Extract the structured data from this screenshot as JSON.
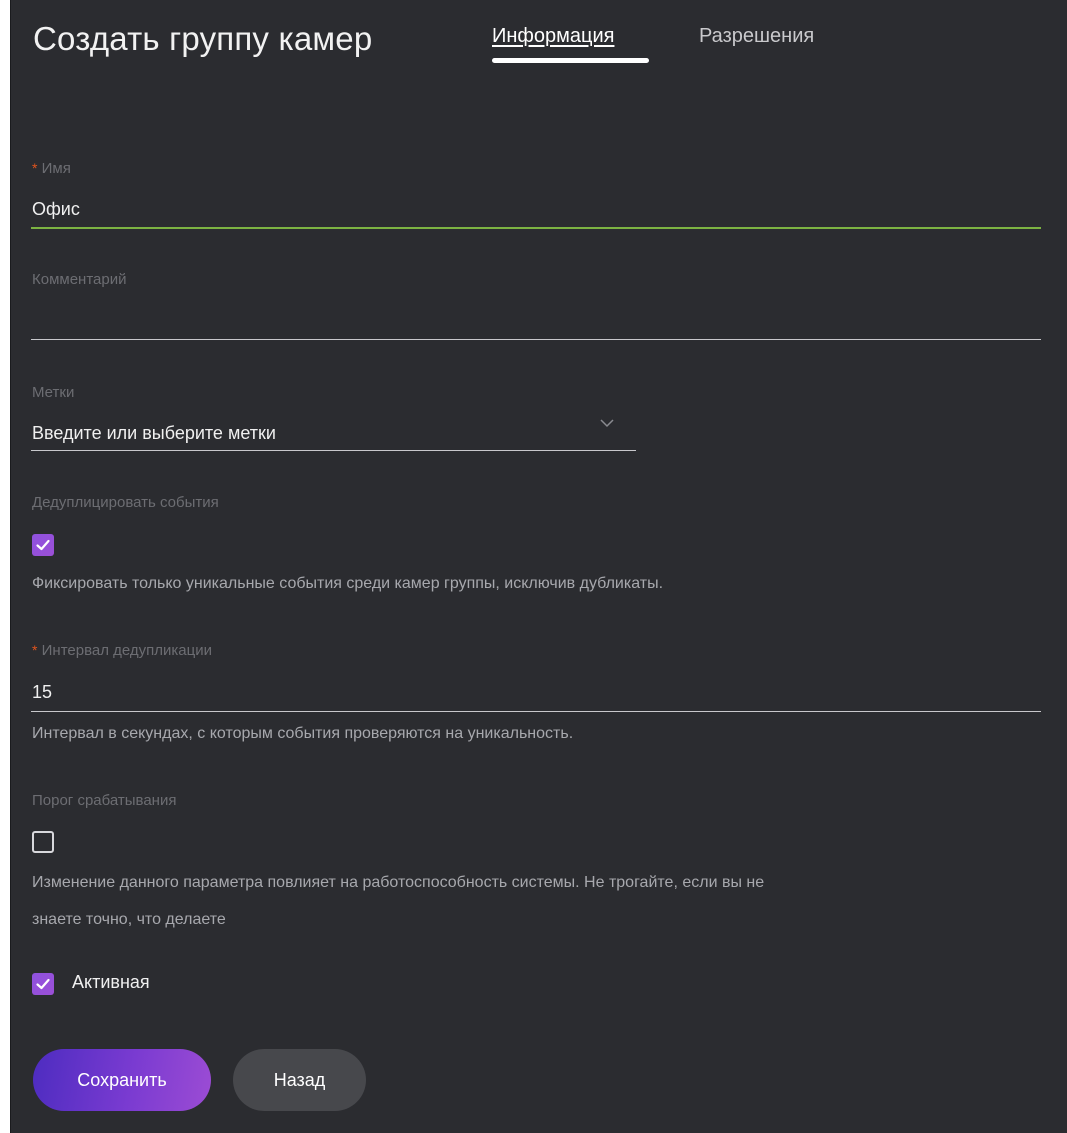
{
  "header": {
    "title": "Создать группу камер",
    "tabs": [
      {
        "label": "Информация",
        "active": true
      },
      {
        "label": "Разрешения",
        "active": false
      }
    ]
  },
  "form": {
    "name": {
      "label": "Имя",
      "required": true,
      "value": "Офис"
    },
    "comment": {
      "label": "Комментарий",
      "value": ""
    },
    "tags": {
      "label": "Метки",
      "placeholder": "Введите или выберите метки"
    },
    "dedup": {
      "label": "Дедуплицировать события",
      "checked": true,
      "hint": "Фиксировать только уникальные события среди камер группы, исключив дубликаты."
    },
    "dedup_interval": {
      "label": "Интервал дедупликации",
      "required": true,
      "value": "15",
      "hint": "Интервал в секундах, с которым события проверяются на уникальность."
    },
    "threshold": {
      "label": "Порог срабатывания",
      "checked": false,
      "hint_line1": "Изменение данного параметра повлияет на работоспособность системы. Не трогайте, если вы не",
      "hint_line2": "знаете точно, что делаете"
    },
    "active": {
      "label": "Активная",
      "checked": true
    }
  },
  "buttons": {
    "save_label": "Сохранить",
    "back_label": "Назад"
  },
  "colors": {
    "background": "#2b2c30",
    "accent": "#8f52df",
    "required": "#e2541d",
    "focus_underline": "#7cb342"
  },
  "icons": {
    "tags_dropdown": "chevron-down-icon",
    "checkmark": "checkmark-icon"
  }
}
